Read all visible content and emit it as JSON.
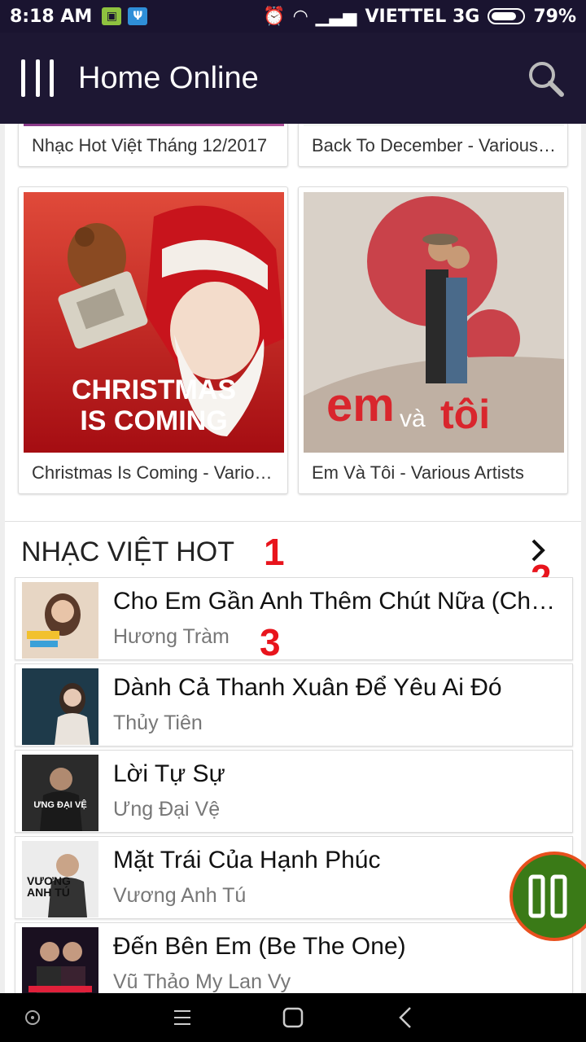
{
  "status_bar": {
    "time": "8:18 AM",
    "carrier": "VIETTEL 3G",
    "battery": "79%"
  },
  "app_bar": {
    "title": "Home Online"
  },
  "albums": [
    {
      "caption": "Nhạc Hot Việt Tháng 12/2017"
    },
    {
      "caption": "Back To December - Various Artists"
    },
    {
      "caption": "Christmas Is Coming - Various Artists",
      "art_text_1": "CHRISTMAS",
      "art_text_2": "IS COMING"
    },
    {
      "caption": "Em Và Tôi - Various Artists",
      "art_text_1": "em",
      "art_text_2": "và",
      "art_text_3": "tôi"
    }
  ],
  "hot_section": {
    "title": "NHẠC VIỆT HOT",
    "annotations": [
      "1",
      "2",
      "3"
    ],
    "songs": [
      {
        "title": "Cho Em Gần Anh Thêm Chút Nữa (Chút Nữa)",
        "artist": "Hương Tràm"
      },
      {
        "title": "Dành Cả Thanh Xuân Để Yêu Ai Đó",
        "artist": "Thủy Tiên"
      },
      {
        "title": "Lời Tự Sự",
        "artist": "Ưng Đại Vệ",
        "thumb_text": "ƯNG ĐẠI VỆ"
      },
      {
        "title": "Mặt Trái Của Hạnh Phúc",
        "artist": "Vương Anh Tú",
        "thumb_text": "VƯƠNG ANH TÚ"
      },
      {
        "title": "Đến Bên Em (Be The One)",
        "artist": "Vũ Thảo My Lan Vy"
      }
    ]
  },
  "colors": {
    "appbar": "#1d1733",
    "accent_red": "#e8141c",
    "fab_green": "#3a7a17",
    "fab_ring": "#e8501e"
  },
  "icons": [
    "menu-icon",
    "search-icon",
    "chevron-right-icon",
    "pause-icon",
    "recent-apps-icon",
    "home-icon",
    "back-icon"
  ]
}
